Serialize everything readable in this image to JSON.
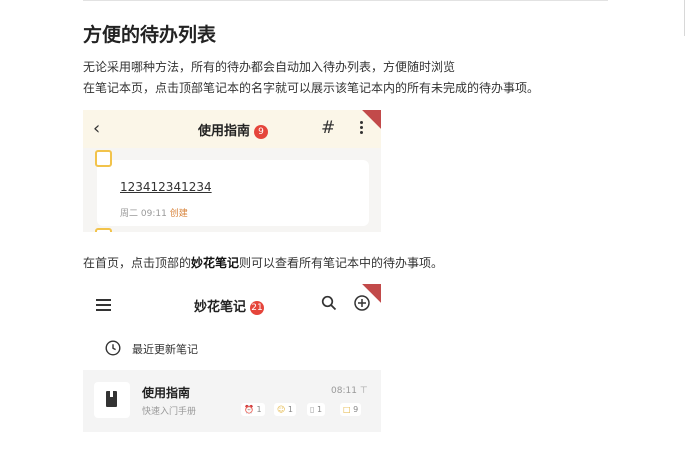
{
  "title": "方便的待办列表",
  "para1_line1": "无论采用哪种方法，所有的待办都会自动加入待办列表，方便随时浏览",
  "para1_line2": "在笔记本页，点击顶部笔记本的名字就可以展示该笔记本内的所有未完成的待办事项。",
  "para2_prefix": "在首页，点击顶部的",
  "para2_bold": "妙花笔记",
  "para2_suffix": "则可以查看所有笔记本中的待办事项。",
  "shot1": {
    "header_title": "使用指南",
    "header_badge": "9",
    "hash_symbol": "#",
    "todo_text": "123412341234",
    "todo_date": "周二 09:11",
    "todo_created": "创建"
  },
  "shot2": {
    "app_title": "妙花笔记",
    "app_badge": "21",
    "recent_label": "最近更新笔记",
    "note_title": "使用指南",
    "note_subtitle": "快速入门手册",
    "note_time": "08:11",
    "chips": [
      "1",
      "1",
      "1",
      "9"
    ]
  },
  "colors": {
    "accent_yellow": "#f2c34b",
    "badge_red": "#e5453b",
    "created_orange": "#d8833a"
  }
}
